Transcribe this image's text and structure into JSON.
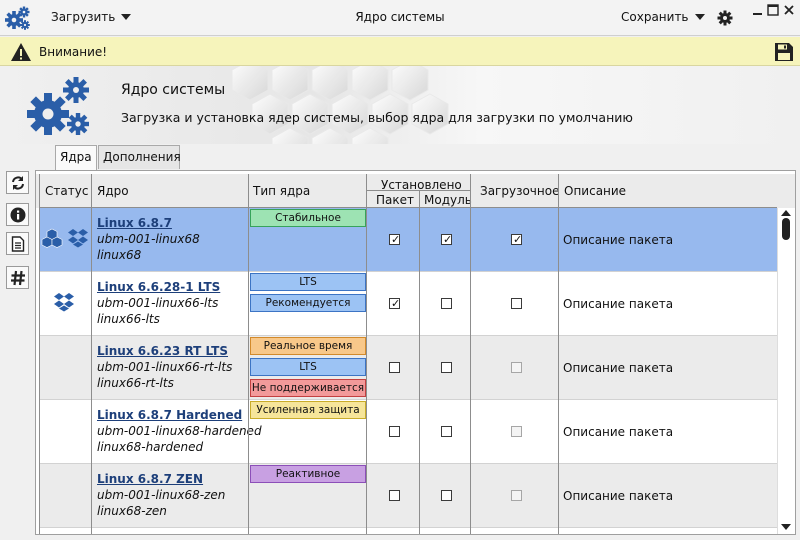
{
  "titlebar": {
    "load_label": "Загрузить",
    "title": "Ядро системы",
    "save_label": "Сохранить"
  },
  "warning": {
    "text": "Внимание!"
  },
  "banner": {
    "title": "Ядро системы",
    "description": "Загрузка и установка ядер системы, выбор ядра для загрузки по умолчанию"
  },
  "tabs": [
    {
      "label": "Ядра",
      "active": true
    },
    {
      "label": "Дополнения",
      "active": false
    }
  ],
  "left_toolbar": [
    "refresh-icon",
    "info-icon",
    "document-icon",
    "hash-icon"
  ],
  "table": {
    "headers": {
      "status": "Статус",
      "kernel": "Ядро",
      "type": "Тип ядра",
      "installed": "Установлено",
      "package": "Пакет",
      "module": "Модуль",
      "boot": "Загрузочное",
      "description": "Описание"
    },
    "rows": [
      {
        "name": "Linux 6.8.7",
        "pkg": "ubm-001-linux68",
        "module": "linux68",
        "badges": [
          {
            "label": "Стабильное",
            "kind": "stable"
          }
        ],
        "status_icons": [
          "boxes-icon",
          "dropbox-icon"
        ],
        "pkg_checked": true,
        "mod_checked": true,
        "boot_checked": true,
        "boot_enabled": true,
        "description": "Описание пакета",
        "selected": true
      },
      {
        "name": "Linux 6.6.28-1 LTS",
        "pkg": "ubm-001-linux66-lts",
        "module": "linux66-lts",
        "badges": [
          {
            "label": "LTS",
            "kind": "lts"
          },
          {
            "label": "Рекомендуется",
            "kind": "lts"
          }
        ],
        "status_icons": [
          "dropbox-icon"
        ],
        "pkg_checked": true,
        "mod_checked": false,
        "boot_checked": false,
        "boot_enabled": true,
        "description": "Описание пакета",
        "selected": false
      },
      {
        "name": "Linux 6.6.23 RT LTS",
        "pkg": "ubm-001-linux66-rt-lts",
        "module": "linux66-rt-lts",
        "badges": [
          {
            "label": "Реальное время",
            "kind": "rt"
          },
          {
            "label": "LTS",
            "kind": "lts"
          },
          {
            "label": "Не поддерживается",
            "kind": "nosup"
          }
        ],
        "status_icons": [],
        "pkg_checked": false,
        "mod_checked": false,
        "boot_checked": false,
        "boot_enabled": false,
        "description": "Описание пакета",
        "selected": false
      },
      {
        "name": "Linux 6.8.7 Hardened",
        "pkg": "ubm-001-linux68-hardened",
        "module": "linux68-hardened",
        "badges": [
          {
            "label": "Усиленная защита",
            "kind": "hard"
          }
        ],
        "status_icons": [],
        "pkg_checked": false,
        "mod_checked": false,
        "boot_checked": false,
        "boot_enabled": false,
        "description": "Описание пакета",
        "selected": false
      },
      {
        "name": "Linux 6.8.7 ZEN",
        "pkg": "ubm-001-linux68-zen",
        "module": "linux68-zen",
        "badges": [
          {
            "label": "Реактивное",
            "kind": "react"
          }
        ],
        "status_icons": [],
        "pkg_checked": false,
        "mod_checked": false,
        "boot_checked": false,
        "boot_enabled": false,
        "description": "Описание пакета",
        "selected": false
      }
    ]
  },
  "colors": {
    "selected_row": "#97b9ee",
    "warning_bar": "#f6f4bb",
    "link": "#1d3f7a",
    "icon_blue": "#2a5ea8"
  }
}
